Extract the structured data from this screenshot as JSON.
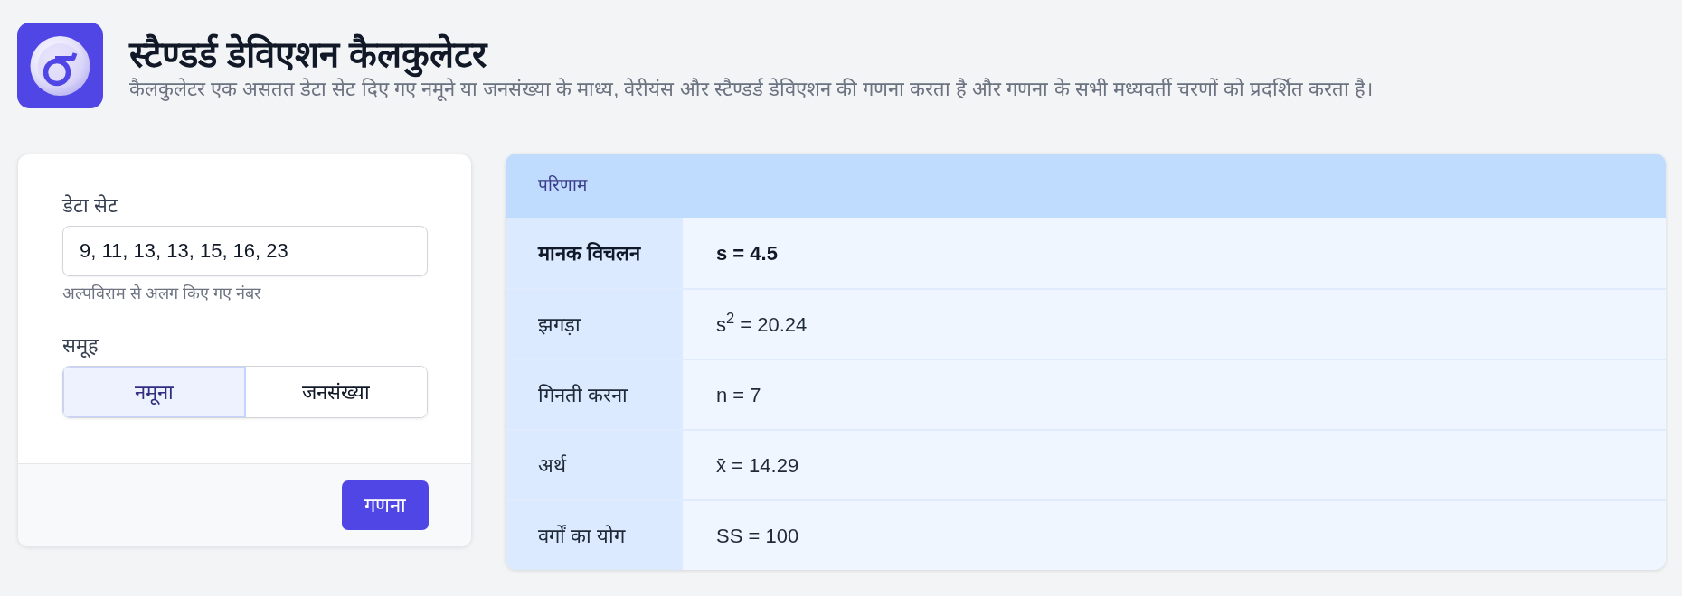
{
  "header": {
    "title": "स्टैण्डर्ड डेविएशन कैलकुलेटर",
    "subtitle": "कैलकुलेटर एक असतत डेटा सेट दिए गए नमूने या जनसंख्या के माध्य, वेरीयंस और स्टैण्डर्ड डेविएशन की गणना करता है और गणना के सभी मध्यवर्ती चरणों को प्रदर्शित करता है।"
  },
  "form": {
    "data_set": {
      "label": "डेटा सेट",
      "value": "9, 11, 13, 13, 15, 16, 23",
      "hint": "अल्पविराम से अलग किए गए नंबर"
    },
    "group": {
      "label": "समूह",
      "options": [
        {
          "label": "नमूना",
          "selected": true
        },
        {
          "label": "जनसंख्या",
          "selected": false
        }
      ]
    },
    "submit": "गणना"
  },
  "results": {
    "title": "परिणाम",
    "rows": [
      {
        "label": "मानक विचलन",
        "value": "s = 4.5",
        "emphasized": true
      },
      {
        "label": "झगड़ा",
        "value": "s$^{2}$ = 20.24",
        "emphasized": false
      },
      {
        "label": "गिनती करना",
        "value": "n = 7",
        "emphasized": false
      },
      {
        "label": "अर्थ",
        "value": "x̄ = 14.29",
        "emphasized": false
      },
      {
        "label": "वर्गों का योग",
        "value": "SS = 100",
        "emphasized": false
      }
    ]
  }
}
